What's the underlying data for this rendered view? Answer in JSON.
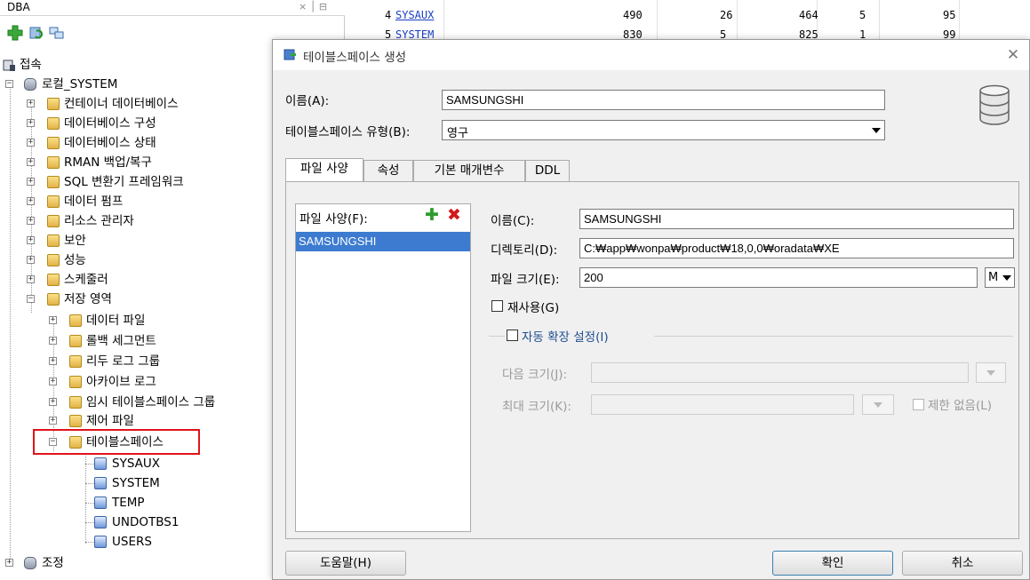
{
  "left_panel": {
    "title": "DBA",
    "title_controls": "× │ ⊟",
    "tree": {
      "connections_label": "접속",
      "root_label": "로컬_SYSTEM",
      "items": [
        {
          "label": "컨테이너 데이터베이스"
        },
        {
          "label": "데이터베이스 구성"
        },
        {
          "label": "데이터베이스 상태"
        },
        {
          "label": "RMAN 백업/복구"
        },
        {
          "label": "SQL 변환기 프레임워크"
        },
        {
          "label": "데이터 펌프"
        },
        {
          "label": "리소스 관리자"
        },
        {
          "label": "보안"
        },
        {
          "label": "성능"
        },
        {
          "label": "스케줄러"
        },
        {
          "label": "저장 영역"
        }
      ],
      "storage_children": [
        {
          "label": "데이터 파일"
        },
        {
          "label": "롤백 세그먼트"
        },
        {
          "label": "리두 로그 그룹"
        },
        {
          "label": "아카이브 로그"
        },
        {
          "label": "임시 테이블스페이스 그룹"
        },
        {
          "label": "제어 파일"
        },
        {
          "label": "테이블스페이스"
        }
      ],
      "tablespaces": [
        "SYSAUX",
        "SYSTEM",
        "TEMP",
        "UNDOTBS1",
        "USERS"
      ],
      "tuning_label": "조정"
    }
  },
  "grid": {
    "rows": [
      {
        "num": "4",
        "name": "SYSAUX",
        "c1": "490",
        "c2": "26",
        "c3": "464",
        "c4": "5",
        "c5": "95"
      },
      {
        "num": "5",
        "name": "SYSTEM",
        "c1": "830",
        "c2": "5",
        "c3": "825",
        "c4": "1",
        "c5": "99"
      }
    ]
  },
  "dialog": {
    "title": "테이블스페이스 생성",
    "name_label": "이름(A):",
    "name_value": "SAMSUNGSHI",
    "type_label": "테이블스페이스 유형(B):",
    "type_value": "영구",
    "tabs": [
      "파일 사양",
      "속성",
      "기본 매개변수",
      "DDL"
    ],
    "file_spec": {
      "list_header": "파일 사양(F):",
      "list_items": [
        "SAMSUNGSHI"
      ],
      "name_label": "이름(C):",
      "name_value": "SAMSUNGSHI",
      "dir_label": "디렉토리(D):",
      "dir_value": "C:₩app₩wonpa₩product₩18,0,0₩oradata₩XE",
      "size_label": "파일 크기(E):",
      "size_value": "200",
      "size_unit": "M",
      "reuse_label": "재사용(G)",
      "autoextend_label": "자동 확장 설정(I)",
      "next_size_label": "다음 크기(J):",
      "max_size_label": "최대 크기(K):",
      "unlimited_label": "제한 없음(L)"
    },
    "buttons": {
      "help": "도움말(H)",
      "ok": "확인",
      "cancel": "취소"
    }
  }
}
